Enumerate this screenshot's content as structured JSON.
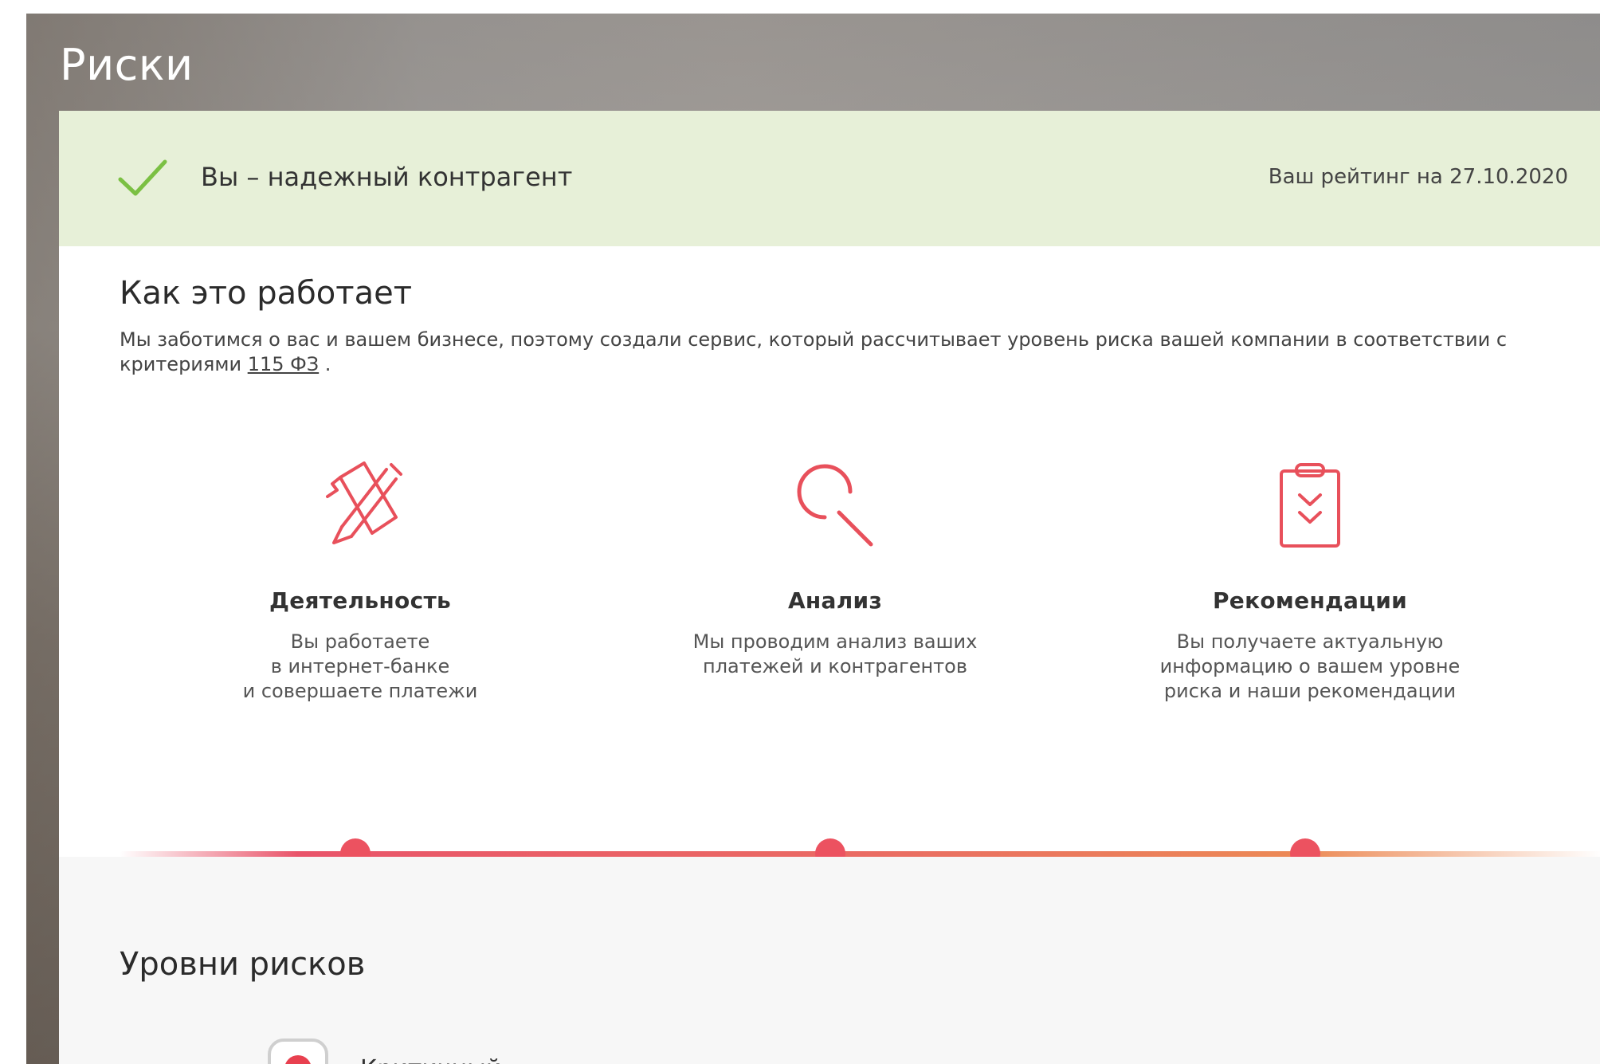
{
  "header": {
    "title": "Риски"
  },
  "status": {
    "text": "Вы – надежный контрагент",
    "rating": "Ваш рейтинг на 27.10.2020",
    "accent_color": "#7bc043",
    "background_color": "#e7f0d8"
  },
  "how_it_works": {
    "title": "Как это работает",
    "intro_text": "Мы заботимся о вас и вашем бизнесе, поэтому создали сервис, который рассчитывает уровень риска вашей компании в соответствии с критериями",
    "intro_link": "115 ФЗ",
    "intro_end": " .",
    "steps": [
      {
        "icon": "pen-document-icon",
        "title": "Деятельность",
        "description": "Вы работаете\nв интернет-банке\nи совершаете платежи"
      },
      {
        "icon": "magnifier-icon",
        "title": "Анализ",
        "description": "Мы проводим анализ ваших\nплатежей и контрагентов"
      },
      {
        "icon": "clipboard-check-icon",
        "title": "Рекомендации",
        "description": "Вы получаете актуальную\nинформацию о вашем уровне\nриска и наши рекомендации"
      }
    ],
    "icon_color": "#e8505b"
  },
  "risk_levels": {
    "title": "Уровни рисков",
    "items": [
      {
        "label": "Критичный",
        "color": "#e8404f"
      }
    ]
  }
}
